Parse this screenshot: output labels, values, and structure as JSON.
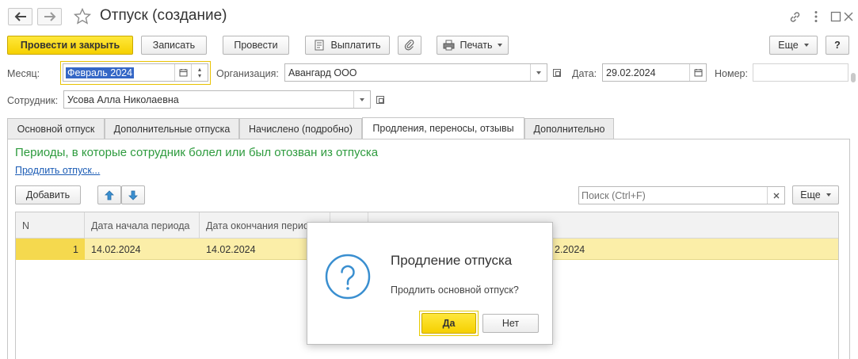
{
  "window": {
    "title": "Отпуск (создание)"
  },
  "toolbar": {
    "post_and_close": "Провести и закрыть",
    "save": "Записать",
    "post": "Провести",
    "pay": "Выплатить",
    "print": "Печать",
    "more": "Еще",
    "help": "?"
  },
  "form": {
    "month_label": "Месяц:",
    "month_value": "Февраль 2024",
    "org_label": "Организация:",
    "org_value": "Авангард ООО",
    "date_label": "Дата:",
    "date_value": "29.02.2024",
    "number_label": "Номер:",
    "number_value": "",
    "employee_label": "Сотрудник:",
    "employee_value": "Усова Алла Николаевна"
  },
  "tabs": [
    {
      "label": "Основной отпуск"
    },
    {
      "label": "Дополнительные отпуска"
    },
    {
      "label": "Начислено (подробно)"
    },
    {
      "label": "Продления, переносы, отзывы"
    },
    {
      "label": "Дополнительно"
    }
  ],
  "panel": {
    "heading": "Периоды, в которые сотрудник болел или был отозван из отпуска",
    "extend_link": "Продлить отпуск...",
    "add_button": "Добавить",
    "search_placeholder": "Поиск (Ctrl+F)",
    "more_button": "Еще"
  },
  "table": {
    "columns": [
      "N",
      "Дата начала периода",
      "Дата окончания периода",
      "",
      ""
    ],
    "rows": [
      {
        "n": "1",
        "start": "14.02.2024",
        "end": "14.02.2024",
        "extra": "2.2024"
      }
    ]
  },
  "dialog": {
    "title": "Продление отпуска",
    "message": "Продлить основной отпуск?",
    "yes": "Да",
    "no": "Нет"
  },
  "colors": {
    "accent_yellow": "#f5d000",
    "green_heading": "#2e9b3e",
    "link_blue": "#1a5bb5",
    "selected_row": "#fbeea8",
    "icon_blue": "#3a8fd0"
  }
}
